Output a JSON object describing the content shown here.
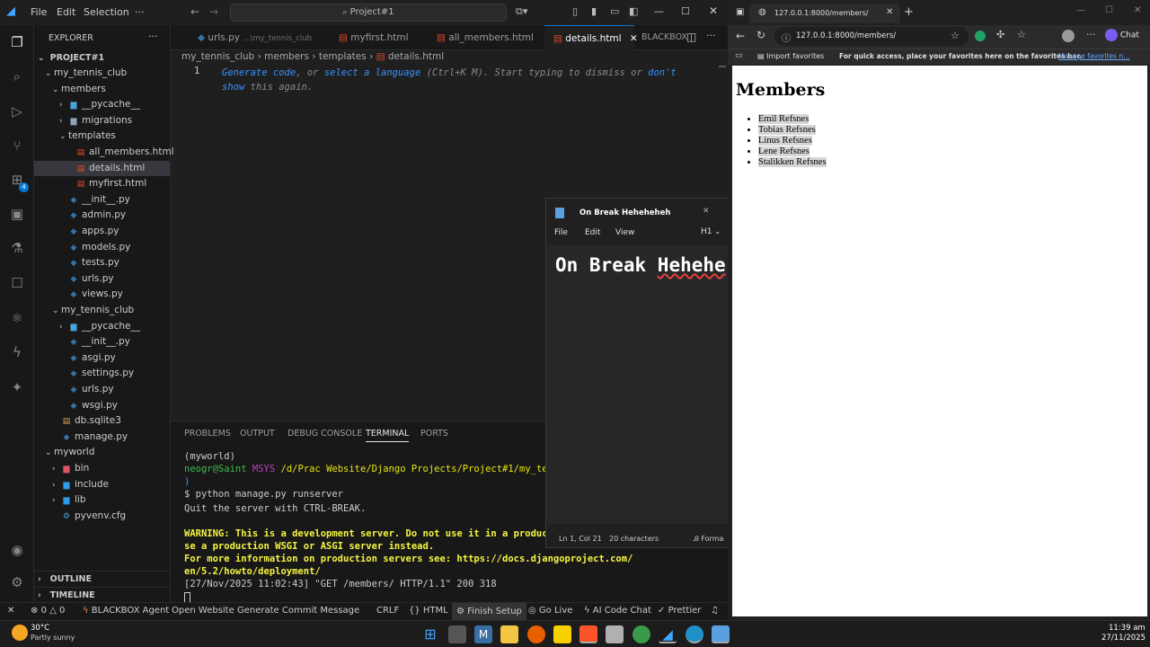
{
  "vscode": {
    "menus": [
      "File",
      "Edit",
      "Selection",
      "···"
    ],
    "command_center": "Project#1",
    "explorer": {
      "title": "EXPLORER",
      "root": "PROJECT#1",
      "tree": [
        {
          "label": "my_tennis_club",
          "kind": "folder-open",
          "depth": 1
        },
        {
          "label": "members",
          "kind": "folder-open",
          "depth": 2
        },
        {
          "label": "__pycache__",
          "kind": "pycache",
          "depth": 3
        },
        {
          "label": "migrations",
          "kind": "folder",
          "depth": 3
        },
        {
          "label": "templates",
          "kind": "folder-open",
          "depth": 3
        },
        {
          "label": "all_members.html",
          "kind": "html",
          "depth": 4
        },
        {
          "label": "details.html",
          "kind": "html",
          "depth": 4,
          "selected": true
        },
        {
          "label": "myfirst.html",
          "kind": "html",
          "depth": 4
        },
        {
          "label": "__init__.py",
          "kind": "py",
          "depth": 3
        },
        {
          "label": "admin.py",
          "kind": "py",
          "depth": 3
        },
        {
          "label": "apps.py",
          "kind": "py",
          "depth": 3
        },
        {
          "label": "models.py",
          "kind": "py",
          "depth": 3
        },
        {
          "label": "tests.py",
          "kind": "py",
          "depth": 3
        },
        {
          "label": "urls.py",
          "kind": "py",
          "depth": 3
        },
        {
          "label": "views.py",
          "kind": "py",
          "depth": 3
        },
        {
          "label": "my_tennis_club",
          "kind": "folder-open",
          "depth": 2
        },
        {
          "label": "__pycache__",
          "kind": "pycache",
          "depth": 3
        },
        {
          "label": "__init__.py",
          "kind": "py",
          "depth": 3
        },
        {
          "label": "asgi.py",
          "kind": "py",
          "depth": 3
        },
        {
          "label": "settings.py",
          "kind": "py",
          "depth": 3
        },
        {
          "label": "urls.py",
          "kind": "py",
          "depth": 3
        },
        {
          "label": "wsgi.py",
          "kind": "py",
          "depth": 3
        },
        {
          "label": "db.sqlite3",
          "kind": "db",
          "depth": 2
        },
        {
          "label": "manage.py",
          "kind": "py",
          "depth": 2
        },
        {
          "label": "myworld",
          "kind": "folder-open",
          "depth": 1
        },
        {
          "label": "bin",
          "kind": "folder-red",
          "depth": 2
        },
        {
          "label": "include",
          "kind": "folder-blue",
          "depth": 2
        },
        {
          "label": "lib",
          "kind": "folder-blue",
          "depth": 2
        },
        {
          "label": "pyvenv.cfg",
          "kind": "cfg",
          "depth": 2
        }
      ],
      "outline": "OUTLINE",
      "timeline": "TIMELINE"
    },
    "tabs": [
      {
        "label": "urls.py",
        "hint": "...\\my_tennis_club",
        "kind": "py"
      },
      {
        "label": "myfirst.html",
        "kind": "html"
      },
      {
        "label": "all_members.html",
        "kind": "html"
      },
      {
        "label": "details.html",
        "kind": "html",
        "active": true
      },
      {
        "label": "BLACKBOX",
        "kind": "none"
      }
    ],
    "breadcrumb": [
      "my_tennis_club",
      "members",
      "templates",
      "details.html"
    ],
    "editor": {
      "line_number": "1",
      "hint_parts": [
        "Generate code",
        ", or ",
        "select a language",
        " (Ctrl+K M). Start typing to dismiss or ",
        "don't",
        "show",
        " this again."
      ]
    },
    "panel": {
      "tabs": [
        "PROBLEMS",
        "OUTPUT",
        "DEBUG CONSOLE",
        "TERMINAL",
        "PORTS"
      ],
      "active_tab": "TERMINAL",
      "terminal": {
        "venv": "(myworld)",
        "user": "neogr@Saint",
        "shell": "MSYS",
        "path": "/d/Prac Website/Django Projects/Project#1/my_tenni",
        "paren": ")",
        "command": "$ python manage.py runserver",
        "quit": "Quit the server with CTRL-BREAK.",
        "warn1": "WARNING: This is a development server. Do not use it in a productio",
        "warn2": "se a production WSGI or ASGI server instead.",
        "info1": "For more information on production servers see: https://docs.djangoproject.com/",
        "info2": "en/5.2/howto/deployment/",
        "log": "[27/Nov/2025 11:02:43] \"GET /members/ HTTP/1.1\" 200 318"
      }
    },
    "status": {
      "errors": "0",
      "warnings": "0",
      "items": [
        "BLACKBOX Agent",
        "Open Website",
        "Generate Commit Message",
        "CRLF",
        "{} HTML",
        "Finish Setup",
        "Go Live",
        "AI Code Chat",
        "Prettier"
      ]
    },
    "badge": "4"
  },
  "notepad": {
    "title": "On Break Heheheheh",
    "menus": [
      "File",
      "Edit",
      "View"
    ],
    "heading_level": "H1",
    "content_a": "On Break ",
    "content_b": "Hehehe",
    "status_pos": "Ln 1, Col 21",
    "status_chars": "20 characters",
    "status_format": "Forma"
  },
  "browser": {
    "tab_title": "127.0.0.1:8000/members/",
    "url": "127.0.0.1:8000/members/",
    "chat_label": "Chat",
    "bookmarks": {
      "import": "Import favorites",
      "message": "For quick access, place your favorites here on the favorites bar.",
      "link": "Manage favorites n..."
    },
    "page": {
      "heading": "Members",
      "members": [
        "Emil Refsnes",
        "Tobias Refsnes",
        "Linus Refsnes",
        "Lene Refsnes",
        "Stalikken Refsnes"
      ]
    }
  },
  "taskbar": {
    "weather_temp": "30°C",
    "weather_desc": "Partly sunny",
    "time": "11:39 am",
    "date": "27/11/2025"
  },
  "colors": {
    "accent": "#0078d4",
    "html_icon": "#e44d26",
    "py_icon": "#3572a5",
    "terminal_user": "#3fb950",
    "terminal_shell": "#bc3fbc",
    "terminal_path": "#e5e510",
    "terminal_warn": "#f5f543"
  }
}
